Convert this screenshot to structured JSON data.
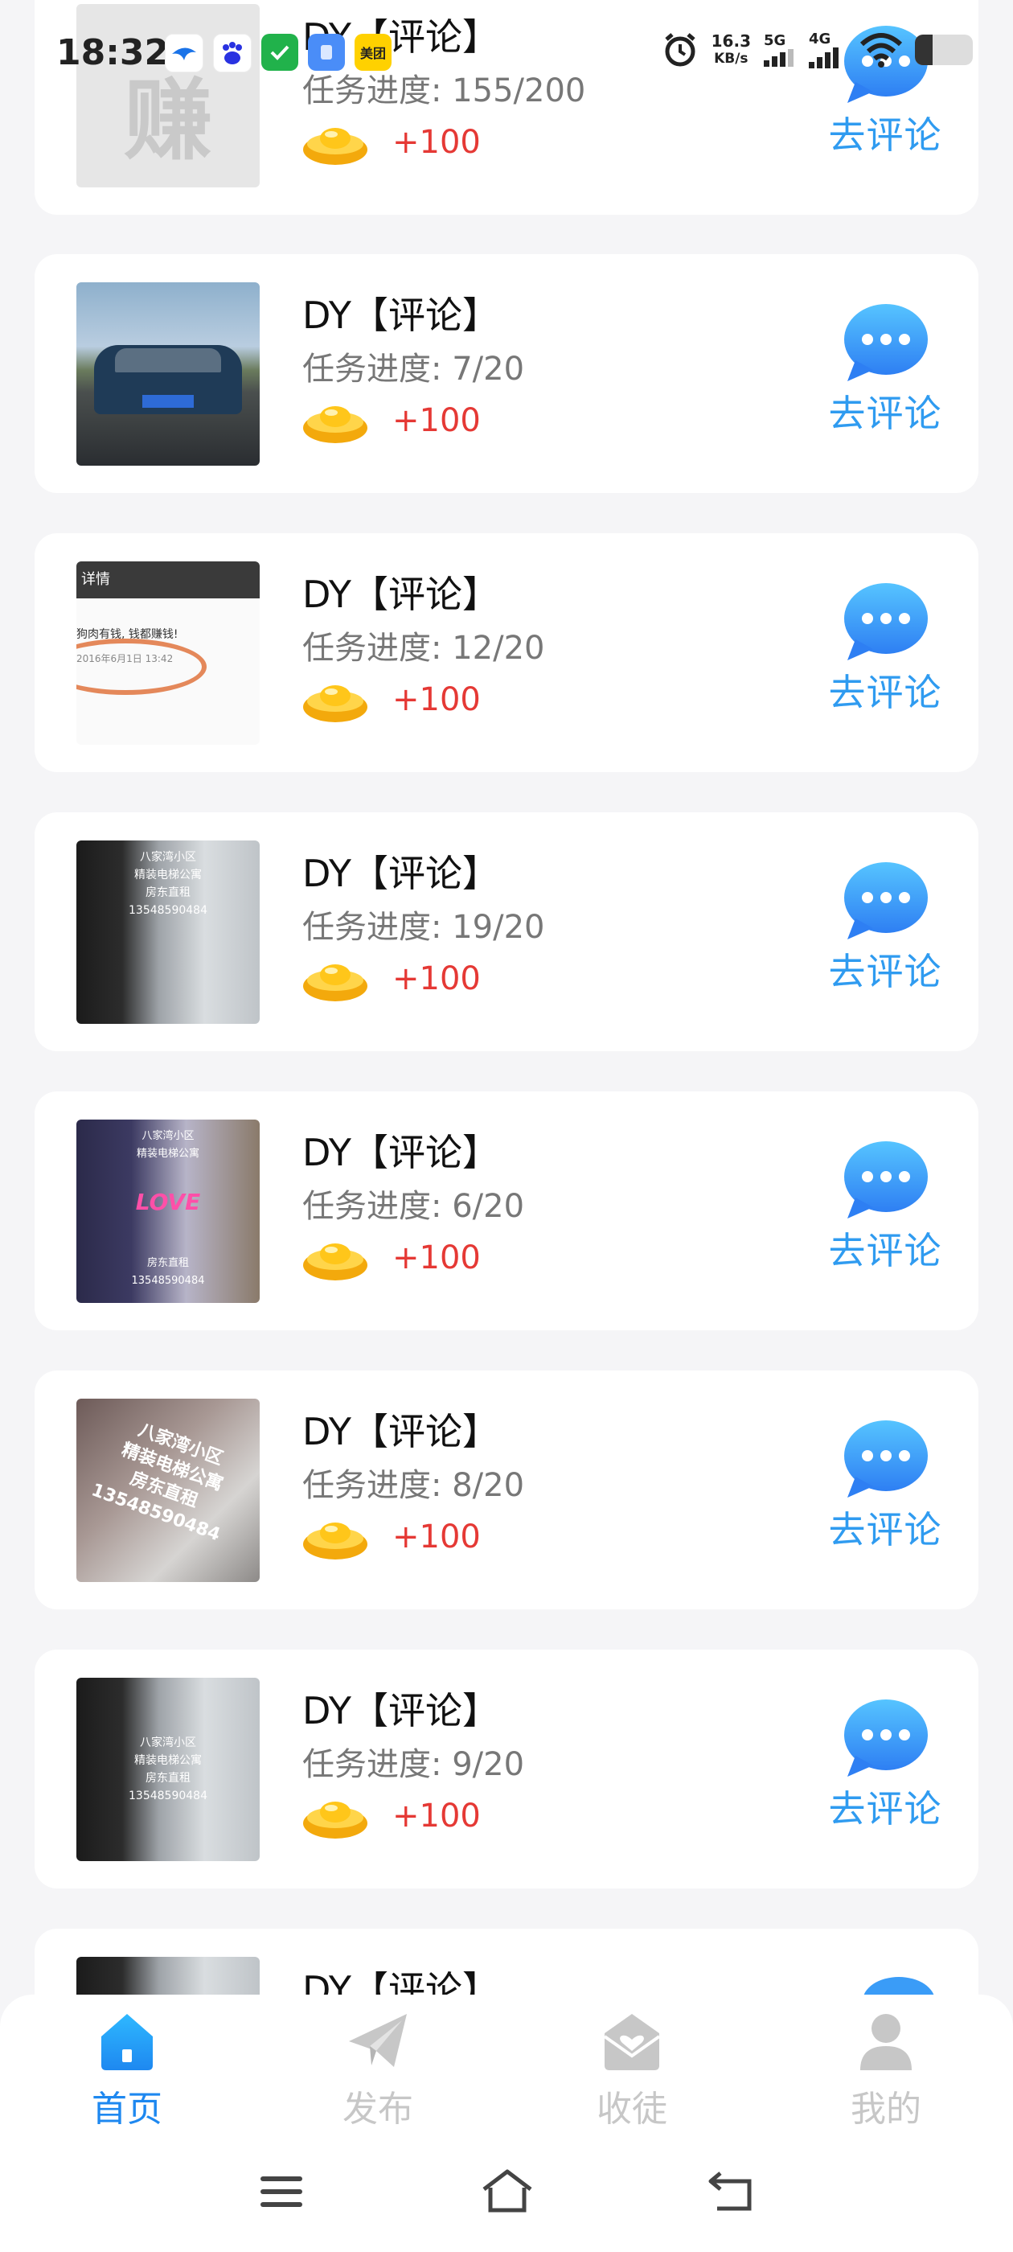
{
  "status_bar": {
    "time": "18:32",
    "net_speed_value": "16.3",
    "net_speed_unit": "KB/s",
    "sig1_label": "5G",
    "sig2_label": "4G",
    "meituan_label": "美团",
    "battery_level": 0.3
  },
  "tasks": [
    {
      "title": "DY【评论】",
      "progress": "任务进度: 155/200",
      "reward": "+100",
      "button": "去评论",
      "thumb_label": "赚"
    },
    {
      "title": "DY【评论】",
      "progress": "任务进度: 7/20",
      "reward": "+100",
      "button": "去评论"
    },
    {
      "title": "DY【评论】",
      "progress": "任务进度: 12/20",
      "reward": "+100",
      "button": "去评论",
      "thumb_header": "详情",
      "thumb_line1": "狗肉有钱, 钱都赚钱!",
      "thumb_line2": "2016年6月1日 13:42"
    },
    {
      "title": "DY【评论】",
      "progress": "任务进度: 19/20",
      "reward": "+100",
      "button": "去评论",
      "thumb_lines": [
        "八家湾小区",
        "精装电梯公寓",
        "房东直租",
        "13548590484"
      ]
    },
    {
      "title": "DY【评论】",
      "progress": "任务进度: 6/20",
      "reward": "+100",
      "button": "去评论",
      "thumb_top": "八家湾小区",
      "thumb_top2": "精装电梯公寓",
      "thumb_love": "LOVE",
      "thumb_lines": [
        "房东直租",
        "13548590484"
      ]
    },
    {
      "title": "DY【评论】",
      "progress": "任务进度: 8/20",
      "reward": "+100",
      "button": "去评论",
      "thumb_lines": [
        "八家湾小区",
        "精装电梯公寓",
        "房东直租",
        "13548590484"
      ]
    },
    {
      "title": "DY【评论】",
      "progress": "任务进度: 9/20",
      "reward": "+100",
      "button": "去评论",
      "thumb_lines": [
        "八家湾小区",
        "精装电梯公寓",
        "房东直租",
        "13548590484"
      ]
    },
    {
      "title": "DY【评论】"
    }
  ],
  "tabs": [
    {
      "label": "首页",
      "icon": "home-icon",
      "active": true
    },
    {
      "label": "发布",
      "icon": "paper-plane-icon",
      "active": false
    },
    {
      "label": "收徒",
      "icon": "heart-mail-icon",
      "active": false
    },
    {
      "label": "我的",
      "icon": "user-icon",
      "active": false
    }
  ],
  "nav_bar": {
    "icons": [
      "menu-icon",
      "home-outline-icon",
      "back-icon"
    ]
  },
  "colors": {
    "accent_blue": "#2f9bf0",
    "reward_red": "#e53935",
    "inactive_tab": "#c7c7c7",
    "background": "#f5f5f7"
  }
}
